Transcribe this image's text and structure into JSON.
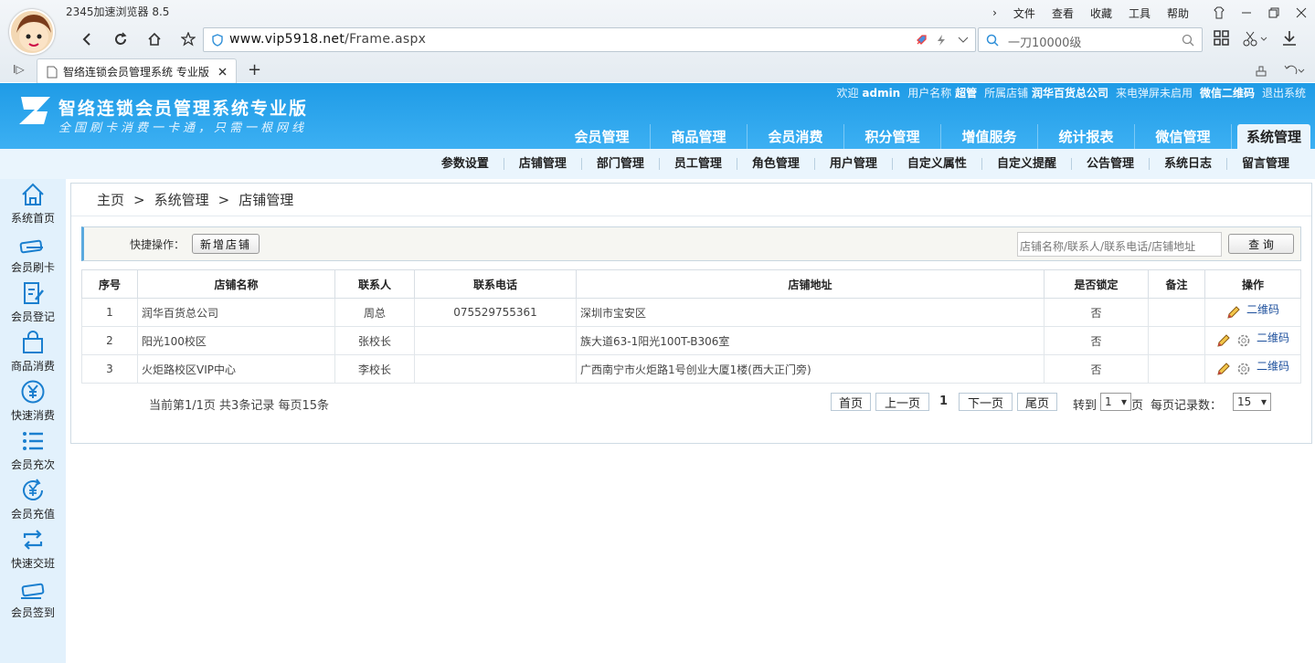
{
  "browser": {
    "name": "2345加速浏览器 8.5",
    "menu": [
      "文件",
      "查看",
      "收藏",
      "工具",
      "帮助"
    ],
    "url_domain": "www.vip5918.net",
    "url_path": "/Frame.aspx",
    "search_text": "一刀10000级",
    "tab_title": "智络连锁会员管理系统 专业版"
  },
  "app": {
    "title": "智络连锁会员管理系统专业版",
    "slogan": "全国刷卡消费一卡通，只需一根网线",
    "user": {
      "welcome": "欢迎",
      "username": "admin",
      "name_label": "用户名称",
      "name": "超管",
      "store_label": "所属店铺",
      "store": "润华百货总公司",
      "popup_status": "来电弹屏未启用",
      "wechat_qr": "微信二维码",
      "logout": "退出系统"
    },
    "main_nav": [
      "会员管理",
      "商品管理",
      "会员消费",
      "积分管理",
      "增值服务",
      "统计报表",
      "微信管理",
      "系统管理"
    ],
    "sub_nav": [
      "参数设置",
      "店铺管理",
      "部门管理",
      "员工管理",
      "角色管理",
      "用户管理",
      "自定义属性",
      "自定义提醒",
      "公告管理",
      "系统日志",
      "留言管理"
    ]
  },
  "sidebar": [
    {
      "label": "系统首页",
      "icon": "home-icon"
    },
    {
      "label": "会员刷卡",
      "icon": "card-swipe-icon"
    },
    {
      "label": "会员登记",
      "icon": "register-icon"
    },
    {
      "label": "商品消费",
      "icon": "shopping-bag-icon"
    },
    {
      "label": "快速消费",
      "icon": "yen-icon"
    },
    {
      "label": "会员充次",
      "icon": "list-icon"
    },
    {
      "label": "会员充值",
      "icon": "yen-refresh-icon"
    },
    {
      "label": "快速交班",
      "icon": "exchange-icon"
    },
    {
      "label": "会员签到",
      "icon": "sign-in-icon"
    }
  ],
  "breadcrumb": [
    "主页",
    ">",
    "系统管理",
    ">",
    "店铺管理"
  ],
  "quick": {
    "label": "快捷操作：",
    "add_button": "新增店铺",
    "search_placeholder": "店铺名称/联系人/联系电话/店铺地址",
    "query_button": "查 询"
  },
  "table": {
    "headers": [
      "序号",
      "店铺名称",
      "联系人",
      "联系电话",
      "店铺地址",
      "是否锁定",
      "备注",
      "操作"
    ],
    "rows": [
      {
        "no": "1",
        "name": "润华百货总公司",
        "contact": "周总",
        "phone": "075529755361",
        "address": "深圳市宝安区",
        "locked": "否",
        "note": "",
        "op": "二维码",
        "has_settings": false
      },
      {
        "no": "2",
        "name": "阳光100校区",
        "contact": "张校长",
        "phone": "",
        "address": "族大道63-1阳光100T-B306室",
        "locked": "否",
        "note": "",
        "op": "二维码",
        "has_settings": true
      },
      {
        "no": "3",
        "name": "火炬路校区VIP中心",
        "contact": "李校长",
        "phone": "",
        "address": "广西南宁市火炬路1号创业大厦1楼(西大正门旁)",
        "locked": "否",
        "note": "",
        "op": "二维码",
        "has_settings": true
      }
    ]
  },
  "pager": {
    "info": "当前第1/1页  共3条记录  每页15条",
    "first": "首页",
    "prev": "上一页",
    "current": "1",
    "next": "下一页",
    "last": "尾页",
    "goto_label": "转到",
    "goto_value": "1",
    "page_unit": "页",
    "per_page_label": "每页记录数：",
    "per_page": "15"
  }
}
